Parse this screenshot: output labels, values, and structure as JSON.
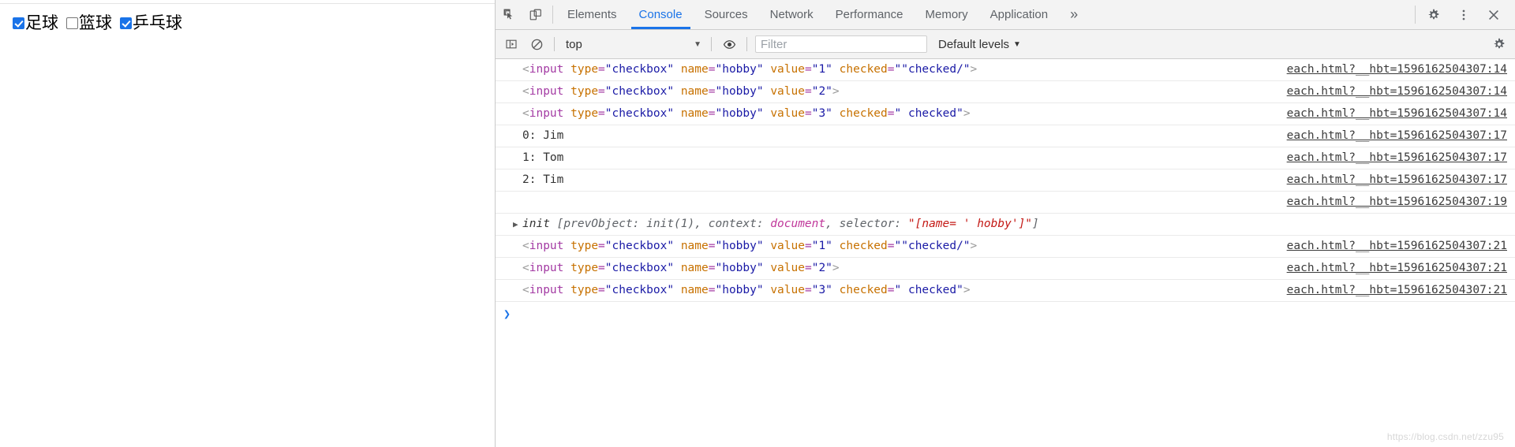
{
  "page": {
    "checkboxes": [
      {
        "label": "足球",
        "checked": true,
        "name": "hobby",
        "value": "1"
      },
      {
        "label": "篮球",
        "checked": false,
        "name": "hobby",
        "value": "2"
      },
      {
        "label": "乒乓球",
        "checked": true,
        "name": "hobby",
        "value": "3"
      }
    ]
  },
  "devtools": {
    "tabs": [
      {
        "label": "Elements",
        "active": false
      },
      {
        "label": "Console",
        "active": true
      },
      {
        "label": "Sources",
        "active": false
      },
      {
        "label": "Network",
        "active": false
      },
      {
        "label": "Performance",
        "active": false
      },
      {
        "label": "Memory",
        "active": false
      },
      {
        "label": "Application",
        "active": false
      }
    ],
    "more_label": "»",
    "icons": {
      "inspect": "inspect-element-icon",
      "device": "device-toolbar-icon",
      "settings": "gear-icon",
      "kebab": "more-options-icon",
      "close": "close-icon"
    },
    "console_toolbar": {
      "sidebar_toggle": "console-sidebar-icon",
      "clear": "clear-console-icon",
      "context": "top",
      "context_caret": "▼",
      "eye": "live-expression-icon",
      "filter_placeholder": "Filter",
      "filter_value": "",
      "levels_label": "Default levels",
      "levels_caret": "▼",
      "settings": "console-settings-icon"
    },
    "messages": [
      {
        "kind": "html",
        "tokens": [
          {
            "t": "punct",
            "s": "<"
          },
          {
            "t": "tag",
            "s": "input"
          },
          {
            "t": "plain",
            "s": " "
          },
          {
            "t": "attr",
            "s": "type"
          },
          {
            "t": "eq",
            "s": "="
          },
          {
            "t": "val",
            "s": "\"checkbox\""
          },
          {
            "t": "plain",
            "s": " "
          },
          {
            "t": "attr",
            "s": "name"
          },
          {
            "t": "eq",
            "s": "="
          },
          {
            "t": "val",
            "s": "\"hobby\""
          },
          {
            "t": "plain",
            "s": " "
          },
          {
            "t": "attr",
            "s": "value"
          },
          {
            "t": "eq",
            "s": "="
          },
          {
            "t": "val",
            "s": "\"1\""
          },
          {
            "t": "plain",
            "s": " "
          },
          {
            "t": "attr",
            "s": "checked"
          },
          {
            "t": "eq",
            "s": "="
          },
          {
            "t": "val",
            "s": "\"\"checked/\""
          },
          {
            "t": "punct",
            "s": ">"
          }
        ],
        "source": "each.html?__hbt=1596162504307:14"
      },
      {
        "kind": "html",
        "tokens": [
          {
            "t": "punct",
            "s": "<"
          },
          {
            "t": "tag",
            "s": "input"
          },
          {
            "t": "plain",
            "s": " "
          },
          {
            "t": "attr",
            "s": "type"
          },
          {
            "t": "eq",
            "s": "="
          },
          {
            "t": "val",
            "s": "\"checkbox\""
          },
          {
            "t": "plain",
            "s": " "
          },
          {
            "t": "attr",
            "s": "name"
          },
          {
            "t": "eq",
            "s": "="
          },
          {
            "t": "val",
            "s": "\"hobby\""
          },
          {
            "t": "plain",
            "s": " "
          },
          {
            "t": "attr",
            "s": "value"
          },
          {
            "t": "eq",
            "s": "="
          },
          {
            "t": "val",
            "s": "\"2\""
          },
          {
            "t": "punct",
            "s": ">"
          }
        ],
        "source": "each.html?__hbt=1596162504307:14"
      },
      {
        "kind": "html",
        "tokens": [
          {
            "t": "punct",
            "s": "<"
          },
          {
            "t": "tag",
            "s": "input"
          },
          {
            "t": "plain",
            "s": " "
          },
          {
            "t": "attr",
            "s": "type"
          },
          {
            "t": "eq",
            "s": "="
          },
          {
            "t": "val",
            "s": "\"checkbox\""
          },
          {
            "t": "plain",
            "s": " "
          },
          {
            "t": "attr",
            "s": "name"
          },
          {
            "t": "eq",
            "s": "="
          },
          {
            "t": "val",
            "s": "\"hobby\""
          },
          {
            "t": "plain",
            "s": " "
          },
          {
            "t": "attr",
            "s": "value"
          },
          {
            "t": "eq",
            "s": "="
          },
          {
            "t": "val",
            "s": "\"3\""
          },
          {
            "t": "plain",
            "s": " "
          },
          {
            "t": "attr",
            "s": "checked"
          },
          {
            "t": "eq",
            "s": "="
          },
          {
            "t": "val",
            "s": "\" checked\""
          },
          {
            "t": "punct",
            "s": ">"
          }
        ],
        "source": "each.html?__hbt=1596162504307:14"
      },
      {
        "kind": "plain",
        "text": "0: Jim",
        "source": "each.html?__hbt=1596162504307:17"
      },
      {
        "kind": "plain",
        "text": "1: Tom",
        "source": "each.html?__hbt=1596162504307:17"
      },
      {
        "kind": "plain",
        "text": "2: Tim",
        "source": "each.html?__hbt=1596162504307:17"
      },
      {
        "kind": "blank",
        "text": "",
        "source": "each.html?__hbt=1596162504307:19"
      },
      {
        "kind": "object",
        "arrow": "▶",
        "parts": [
          {
            "t": "name",
            "s": "init "
          },
          {
            "t": "grey",
            "s": "[prevObject: init(1), context: "
          },
          {
            "t": "doc",
            "s": "document"
          },
          {
            "t": "grey",
            "s": ", selector: "
          },
          {
            "t": "str",
            "s": "\"[name= ' hobby']\""
          },
          {
            "t": "grey",
            "s": "]"
          }
        ],
        "source": ""
      },
      {
        "kind": "html",
        "tokens": [
          {
            "t": "punct",
            "s": "<"
          },
          {
            "t": "tag",
            "s": "input"
          },
          {
            "t": "plain",
            "s": " "
          },
          {
            "t": "attr",
            "s": "type"
          },
          {
            "t": "eq",
            "s": "="
          },
          {
            "t": "val",
            "s": "\"checkbox\""
          },
          {
            "t": "plain",
            "s": " "
          },
          {
            "t": "attr",
            "s": "name"
          },
          {
            "t": "eq",
            "s": "="
          },
          {
            "t": "val",
            "s": "\"hobby\""
          },
          {
            "t": "plain",
            "s": " "
          },
          {
            "t": "attr",
            "s": "value"
          },
          {
            "t": "eq",
            "s": "="
          },
          {
            "t": "val",
            "s": "\"1\""
          },
          {
            "t": "plain",
            "s": " "
          },
          {
            "t": "attr",
            "s": "checked"
          },
          {
            "t": "eq",
            "s": "="
          },
          {
            "t": "val",
            "s": "\"\"checked/\""
          },
          {
            "t": "punct",
            "s": ">"
          }
        ],
        "source": "each.html?__hbt=1596162504307:21"
      },
      {
        "kind": "html",
        "tokens": [
          {
            "t": "punct",
            "s": "<"
          },
          {
            "t": "tag",
            "s": "input"
          },
          {
            "t": "plain",
            "s": " "
          },
          {
            "t": "attr",
            "s": "type"
          },
          {
            "t": "eq",
            "s": "="
          },
          {
            "t": "val",
            "s": "\"checkbox\""
          },
          {
            "t": "plain",
            "s": " "
          },
          {
            "t": "attr",
            "s": "name"
          },
          {
            "t": "eq",
            "s": "="
          },
          {
            "t": "val",
            "s": "\"hobby\""
          },
          {
            "t": "plain",
            "s": " "
          },
          {
            "t": "attr",
            "s": "value"
          },
          {
            "t": "eq",
            "s": "="
          },
          {
            "t": "val",
            "s": "\"2\""
          },
          {
            "t": "punct",
            "s": ">"
          }
        ],
        "source": "each.html?__hbt=1596162504307:21"
      },
      {
        "kind": "html",
        "tokens": [
          {
            "t": "punct",
            "s": "<"
          },
          {
            "t": "tag",
            "s": "input"
          },
          {
            "t": "plain",
            "s": " "
          },
          {
            "t": "attr",
            "s": "type"
          },
          {
            "t": "eq",
            "s": "="
          },
          {
            "t": "val",
            "s": "\"checkbox\""
          },
          {
            "t": "plain",
            "s": " "
          },
          {
            "t": "attr",
            "s": "name"
          },
          {
            "t": "eq",
            "s": "="
          },
          {
            "t": "val",
            "s": "\"hobby\""
          },
          {
            "t": "plain",
            "s": " "
          },
          {
            "t": "attr",
            "s": "value"
          },
          {
            "t": "eq",
            "s": "="
          },
          {
            "t": "val",
            "s": "\"3\""
          },
          {
            "t": "plain",
            "s": " "
          },
          {
            "t": "attr",
            "s": "checked"
          },
          {
            "t": "eq",
            "s": "="
          },
          {
            "t": "val",
            "s": "\" checked\""
          },
          {
            "t": "punct",
            "s": ">"
          }
        ],
        "source": "each.html?__hbt=1596162504307:21"
      }
    ],
    "prompt": "❯"
  },
  "watermark": "https://blog.csdn.net/zzu95",
  "colors": {
    "accent": "#1a73e8",
    "toolbar_bg": "#f3f3f3",
    "border": "#cdcdcd",
    "tag": "#a33aa3",
    "attr": "#c77100",
    "value": "#1a1aa6",
    "string": "#c41a16",
    "document": "#c0379a"
  }
}
